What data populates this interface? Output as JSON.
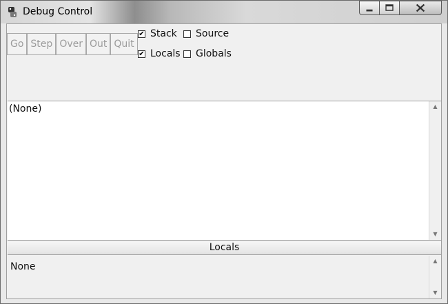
{
  "window": {
    "title": "Debug Control"
  },
  "toolbar": {
    "buttons": [
      "Go",
      "Step",
      "Over",
      "Out",
      "Quit"
    ]
  },
  "options": {
    "stack": {
      "label": "Stack",
      "checked": true
    },
    "source": {
      "label": "Source",
      "checked": false
    },
    "locals": {
      "label": "Locals",
      "checked": true
    },
    "globals": {
      "label": "Globals",
      "checked": false
    }
  },
  "stack_pane": {
    "text": "(None)"
  },
  "locals_section": {
    "header": "Locals",
    "text": "None"
  },
  "glyphs": {
    "checked": "✔",
    "unchecked": "",
    "up": "▲",
    "down": "▼"
  }
}
